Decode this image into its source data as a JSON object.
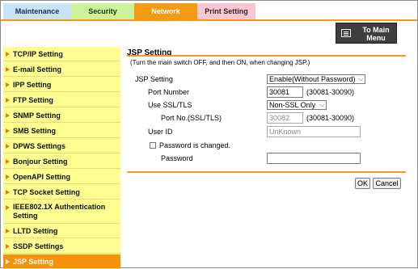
{
  "tabs": [
    {
      "label": "Maintenance"
    },
    {
      "label": "Security"
    },
    {
      "label": "Network"
    },
    {
      "label": "Print Setting"
    }
  ],
  "main_menu": {
    "label_line1": "To Main",
    "label_line2": "Menu"
  },
  "sidebar": {
    "items": [
      {
        "label": "TCP/IP Setting"
      },
      {
        "label": "E-mail Setting"
      },
      {
        "label": "IPP Setting"
      },
      {
        "label": "FTP Setting"
      },
      {
        "label": "SNMP Setting"
      },
      {
        "label": "SMB Setting"
      },
      {
        "label": "DPWS Settings"
      },
      {
        "label": "Bonjour Setting"
      },
      {
        "label": "OpenAPI Setting"
      },
      {
        "label": "TCP Socket Setting"
      },
      {
        "label": "IEEE802.1X Authentication Setting"
      },
      {
        "label": "LLTD Setting"
      },
      {
        "label": "SSDP Settings"
      },
      {
        "label": "JSP Setting"
      }
    ],
    "active": "JSP Setting"
  },
  "form": {
    "title": "JSP Setting",
    "note": "(Turn the main switch OFF, and then ON, when changing JSP.)",
    "jsp_setting_label": "JSP Setting",
    "jsp_setting_value": "Enable(Without Password)",
    "port_number_label": "Port Number",
    "port_number_value": "30081",
    "port_number_range": "(30081-30090)",
    "use_ssl_label": "Use SSL/TLS",
    "use_ssl_value": "Non-SSL Only",
    "ssl_port_label": "Port No.(SSL/TLS)",
    "ssl_port_value": "30082",
    "ssl_port_range": "(30081-30090)",
    "user_id_label": "User ID",
    "user_id_value": "UnKnown",
    "password_changed_label": "Password is changed.",
    "password_label": "Password",
    "password_value": ""
  },
  "buttons": {
    "ok": "OK",
    "cancel": "Cancel"
  },
  "colors": {
    "accent": "#f59a14",
    "sidebar_bg": "#fdfd90"
  }
}
